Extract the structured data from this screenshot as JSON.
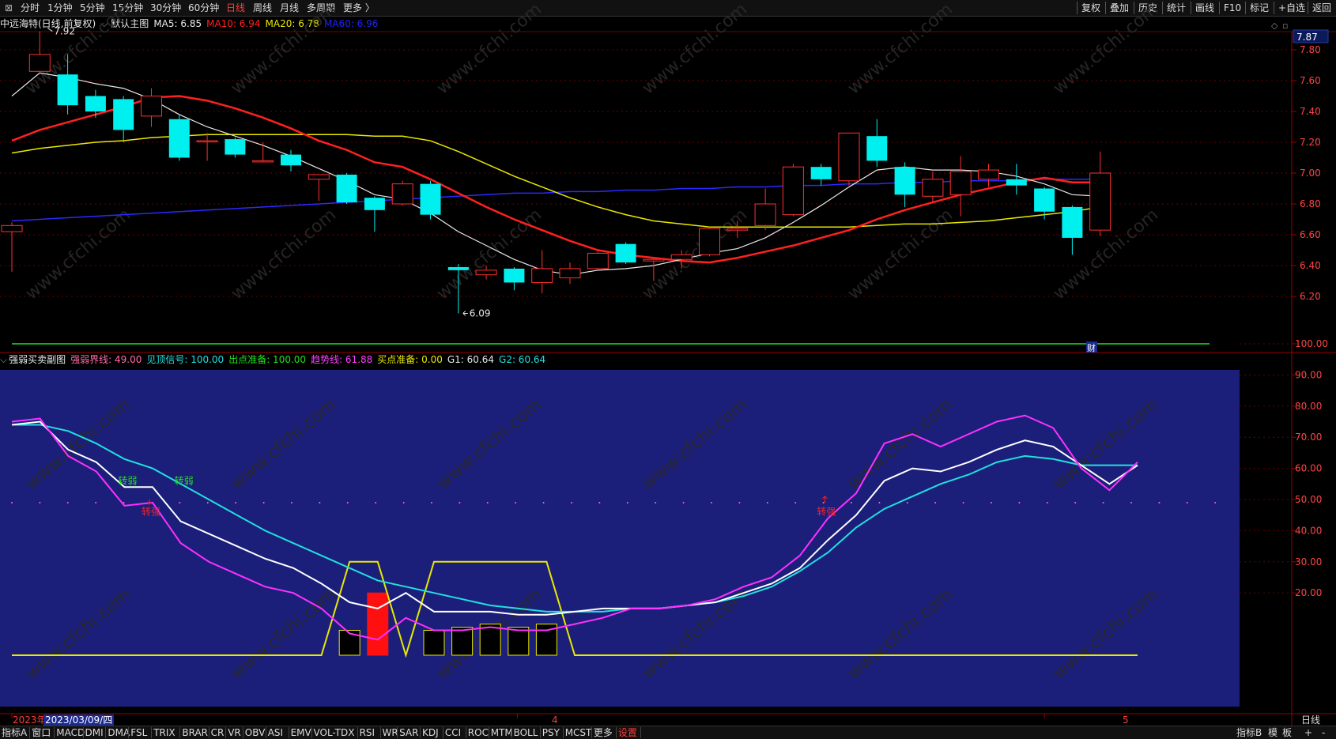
{
  "toolbar": {
    "left_items": [
      "分时",
      "1分钟",
      "5分钟",
      "15分钟",
      "30分钟",
      "60分钟",
      "日线",
      "周线",
      "月线",
      "多周期",
      "更多 〉"
    ],
    "active": "日线",
    "right_items": [
      "复权",
      "叠加",
      "历史",
      "统计",
      "画线",
      "F10",
      "标记",
      "+自选",
      "返回"
    ]
  },
  "main_header": {
    "stock": "中远海特(日线,前复权)",
    "template": "默认主图",
    "ma": [
      {
        "label": "MA5: 6.85",
        "color": "#e8e8e8"
      },
      {
        "label": "MA10: 6.94",
        "color": "#ff2020"
      },
      {
        "label": "MA20: 6.78",
        "color": "#e8e800"
      },
      {
        "label": "MA60: 6.96",
        "color": "#2020ff"
      }
    ]
  },
  "sub_header": {
    "name": "强弱买卖副图",
    "items": [
      {
        "label": "强弱界线: 49.00",
        "color": "#ff6ea8"
      },
      {
        "label": "见顶信号: 100.00",
        "color": "#20e0e0"
      },
      {
        "label": "出点准备: 100.00",
        "color": "#20e020"
      },
      {
        "label": "趋势线: 61.88",
        "color": "#ff40ff"
      },
      {
        "label": "买点准备: 0.00",
        "color": "#e8e800"
      },
      {
        "label": "G1: 60.64",
        "color": "#e8e8e8"
      },
      {
        "label": "G2: 60.64",
        "color": "#20e0e0"
      }
    ]
  },
  "price_axis": {
    "current": "7.87",
    "ticks": [
      "7.80",
      "7.60",
      "7.40",
      "7.20",
      "7.00",
      "6.80",
      "6.60",
      "6.40",
      "6.20"
    ]
  },
  "indicator_axis": {
    "ticks": [
      "100.00",
      "90.00",
      "80.00",
      "70.00",
      "60.00",
      "50.00",
      "40.00",
      "30.00",
      "20.00"
    ]
  },
  "annotations": {
    "high": "7.92",
    "low": "6.09",
    "cai": "财",
    "signals": [
      "转弱",
      "转弱",
      "转强",
      "转强"
    ]
  },
  "date_bar": {
    "year": "2023年",
    "date": "2023/03/09/四",
    "month4": "4",
    "month5": "5",
    "period": "日线"
  },
  "watermark": "www.cfchi.com",
  "bottom_tabs": [
    "指标A",
    "窗口",
    "MACD",
    "DMI",
    "DMA",
    "FSL",
    "TRIX",
    "BRAR",
    "CR",
    "VR",
    "OBV",
    "ASI",
    "EMV",
    "VOL-TDX",
    "RSI",
    "WR",
    "SAR",
    "KDJ",
    "CCI",
    "ROC",
    "MTM",
    "BOLL",
    "PSY",
    "MCST",
    "更多",
    "设置"
  ],
  "bottom_right": [
    "指标B",
    "模",
    "板",
    "+",
    "-"
  ],
  "chart_data": {
    "type": "candlestick",
    "candles": [
      {
        "o": 6.62,
        "h": 6.68,
        "l": 6.36,
        "c": 6.66
      },
      {
        "o": 7.66,
        "h": 7.92,
        "l": 7.64,
        "c": 7.77
      },
      {
        "o": 7.64,
        "h": 7.77,
        "l": 7.38,
        "c": 7.44
      },
      {
        "o": 7.5,
        "h": 7.54,
        "l": 7.36,
        "c": 7.4
      },
      {
        "o": 7.48,
        "h": 7.5,
        "l": 7.2,
        "c": 7.28
      },
      {
        "o": 7.37,
        "h": 7.55,
        "l": 7.3,
        "c": 7.5
      },
      {
        "o": 7.35,
        "h": 7.38,
        "l": 7.08,
        "c": 7.1
      },
      {
        "o": 7.21,
        "h": 7.26,
        "l": 7.08,
        "c": 7.21
      },
      {
        "o": 7.22,
        "h": 7.23,
        "l": 7.1,
        "c": 7.12
      },
      {
        "o": 7.08,
        "h": 7.2,
        "l": 7.07,
        "c": 7.08
      },
      {
        "o": 7.12,
        "h": 7.15,
        "l": 7.01,
        "c": 7.05
      },
      {
        "o": 6.96,
        "h": 6.99,
        "l": 6.82,
        "c": 6.99
      },
      {
        "o": 6.99,
        "h": 7.0,
        "l": 6.8,
        "c": 6.81
      },
      {
        "o": 6.84,
        "h": 6.85,
        "l": 6.62,
        "c": 6.76
      },
      {
        "o": 6.8,
        "h": 6.95,
        "l": 6.79,
        "c": 6.93
      },
      {
        "o": 6.93,
        "h": 6.95,
        "l": 6.7,
        "c": 6.73
      },
      {
        "o": 6.39,
        "h": 6.41,
        "l": 6.09,
        "c": 6.37
      },
      {
        "o": 6.34,
        "h": 6.4,
        "l": 6.31,
        "c": 6.37
      },
      {
        "o": 6.38,
        "h": 6.39,
        "l": 6.24,
        "c": 6.29
      },
      {
        "o": 6.29,
        "h": 6.5,
        "l": 6.22,
        "c": 6.38
      },
      {
        "o": 6.32,
        "h": 6.42,
        "l": 6.28,
        "c": 6.38
      },
      {
        "o": 6.38,
        "h": 6.49,
        "l": 6.37,
        "c": 6.48
      },
      {
        "o": 6.54,
        "h": 6.55,
        "l": 6.41,
        "c": 6.42
      },
      {
        "o": 6.43,
        "h": 6.45,
        "l": 6.3,
        "c": 6.44
      },
      {
        "o": 6.44,
        "h": 6.5,
        "l": 6.38,
        "c": 6.47
      },
      {
        "o": 6.47,
        "h": 6.65,
        "l": 6.46,
        "c": 6.64
      },
      {
        "o": 6.63,
        "h": 6.69,
        "l": 6.58,
        "c": 6.64
      },
      {
        "o": 6.66,
        "h": 6.9,
        "l": 6.63,
        "c": 6.8
      },
      {
        "o": 6.73,
        "h": 7.06,
        "l": 6.72,
        "c": 7.04
      },
      {
        "o": 7.04,
        "h": 7.06,
        "l": 6.92,
        "c": 6.96
      },
      {
        "o": 6.95,
        "h": 7.26,
        "l": 6.92,
        "c": 7.26
      },
      {
        "o": 7.24,
        "h": 7.35,
        "l": 7.04,
        "c": 7.08
      },
      {
        "o": 7.04,
        "h": 7.07,
        "l": 6.78,
        "c": 6.86
      },
      {
        "o": 6.85,
        "h": 7.01,
        "l": 6.81,
        "c": 6.96
      },
      {
        "o": 6.86,
        "h": 7.11,
        "l": 6.72,
        "c": 7.01
      },
      {
        "o": 6.96,
        "h": 7.06,
        "l": 6.91,
        "c": 7.02
      },
      {
        "o": 6.96,
        "h": 7.06,
        "l": 6.86,
        "c": 6.92
      },
      {
        "o": 6.9,
        "h": 6.91,
        "l": 6.7,
        "c": 6.75
      },
      {
        "o": 6.78,
        "h": 6.79,
        "l": 6.47,
        "c": 6.58
      },
      {
        "o": 6.63,
        "h": 7.14,
        "l": 6.59,
        "c": 7.0
      }
    ],
    "ma5": [
      7.5,
      7.65,
      7.62,
      7.58,
      7.55,
      7.48,
      7.38,
      7.3,
      7.24,
      7.18,
      7.11,
      7.03,
      6.95,
      6.86,
      6.83,
      6.74,
      6.62,
      6.53,
      6.44,
      6.37,
      6.34,
      6.37,
      6.38,
      6.4,
      6.44,
      6.48,
      6.51,
      6.58,
      6.68,
      6.79,
      6.91,
      7.02,
      7.04,
      7.02,
      7.02,
      7.01,
      6.98,
      6.93,
      6.86,
      6.85
    ],
    "ma10": [
      7.21,
      7.28,
      7.33,
      7.38,
      7.43,
      7.49,
      7.5,
      7.47,
      7.42,
      7.36,
      7.29,
      7.21,
      7.15,
      7.07,
      7.04,
      6.96,
      6.87,
      6.78,
      6.7,
      6.63,
      6.56,
      6.5,
      6.47,
      6.45,
      6.43,
      6.42,
      6.45,
      6.49,
      6.53,
      6.58,
      6.63,
      6.7,
      6.76,
      6.81,
      6.86,
      6.9,
      6.94,
      6.97,
      6.94,
      6.94
    ],
    "ma20": [
      7.13,
      7.16,
      7.18,
      7.2,
      7.21,
      7.23,
      7.24,
      7.25,
      7.25,
      7.25,
      7.25,
      7.25,
      7.25,
      7.24,
      7.24,
      7.21,
      7.14,
      7.06,
      6.98,
      6.91,
      6.84,
      6.78,
      6.73,
      6.69,
      6.67,
      6.65,
      6.65,
      6.65,
      6.65,
      6.65,
      6.65,
      6.66,
      6.67,
      6.67,
      6.68,
      6.69,
      6.71,
      6.73,
      6.75,
      6.78
    ],
    "ma60": [
      6.69,
      6.7,
      6.71,
      6.72,
      6.73,
      6.74,
      6.75,
      6.76,
      6.77,
      6.78,
      6.79,
      6.8,
      6.81,
      6.82,
      6.83,
      6.84,
      6.85,
      6.86,
      6.87,
      6.87,
      6.88,
      6.88,
      6.89,
      6.89,
      6.9,
      6.9,
      6.91,
      6.91,
      6.92,
      6.92,
      6.93,
      6.93,
      6.94,
      6.94,
      6.95,
      6.95,
      6.95,
      6.96,
      6.96,
      6.96
    ],
    "indicator": {
      "trend": [
        75,
        76,
        64,
        59,
        48,
        49,
        36,
        30,
        26,
        22,
        20,
        15,
        7,
        5,
        12,
        8,
        8,
        9,
        8,
        8,
        10,
        12,
        15,
        15,
        16,
        18,
        22,
        25,
        32,
        44,
        52,
        68,
        71,
        67,
        71,
        75,
        77,
        73,
        60,
        53,
        62
      ],
      "g1": [
        74,
        75,
        66,
        62,
        54,
        54,
        43,
        39,
        35,
        31,
        28,
        23,
        17,
        15,
        20,
        14,
        14,
        14,
        13,
        13,
        14,
        15,
        15,
        15,
        16,
        17,
        20,
        23,
        28,
        37,
        45,
        56,
        60,
        59,
        62,
        66,
        69,
        67,
        61,
        55,
        61
      ],
      "g2": [
        74,
        74,
        72,
        68,
        63,
        60,
        55,
        50,
        45,
        40,
        36,
        32,
        28,
        24,
        22,
        20,
        18,
        16,
        15,
        14,
        14,
        14,
        15,
        15,
        16,
        17,
        19,
        22,
        27,
        33,
        41,
        47,
        51,
        55,
        58,
        62,
        64,
        63,
        61,
        61,
        61
      ],
      "buy_line": [
        0,
        0,
        0,
        0,
        0,
        0,
        0,
        0,
        0,
        0,
        0,
        0,
        30,
        30,
        0,
        30,
        30,
        30,
        30,
        30,
        0,
        0,
        0,
        0,
        0,
        0,
        0,
        0,
        0,
        0,
        0,
        0,
        0,
        0,
        0,
        0,
        0,
        0,
        0,
        0,
        0
      ],
      "bars": [
        0,
        0,
        0,
        0,
        0,
        0,
        0,
        0,
        0,
        0,
        0,
        0,
        8,
        20,
        0,
        8,
        9,
        10,
        9,
        10,
        0,
        0,
        0,
        0,
        0,
        0,
        0,
        0,
        0,
        0,
        0,
        0,
        0,
        0,
        0,
        0,
        0,
        0,
        0,
        0,
        0
      ],
      "threshold": 49,
      "top_signal": 100
    }
  }
}
